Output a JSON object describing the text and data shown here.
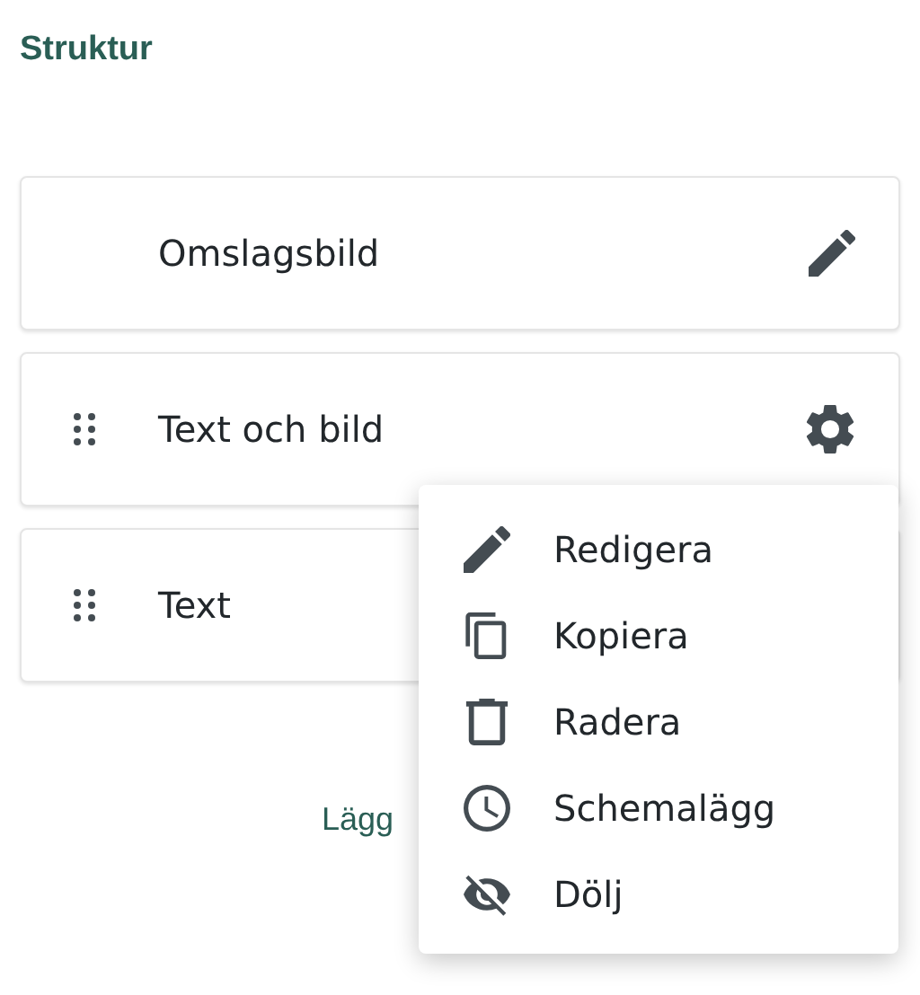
{
  "title": "Struktur",
  "sections": [
    {
      "label": "Omslagsbild",
      "draggable": false,
      "kind": "edit"
    },
    {
      "label": "Text och bild",
      "draggable": true,
      "kind": "settings"
    },
    {
      "label": "Text",
      "draggable": true
    }
  ],
  "add_link": "Lägg",
  "menu": [
    {
      "label": "Redigera",
      "kind": "edit"
    },
    {
      "label": "Kopiera",
      "kind": "copy"
    },
    {
      "label": "Radera",
      "kind": "delete"
    },
    {
      "label": "Schemalägg",
      "kind": "schedule"
    },
    {
      "label": "Dölj",
      "kind": "hide"
    }
  ]
}
